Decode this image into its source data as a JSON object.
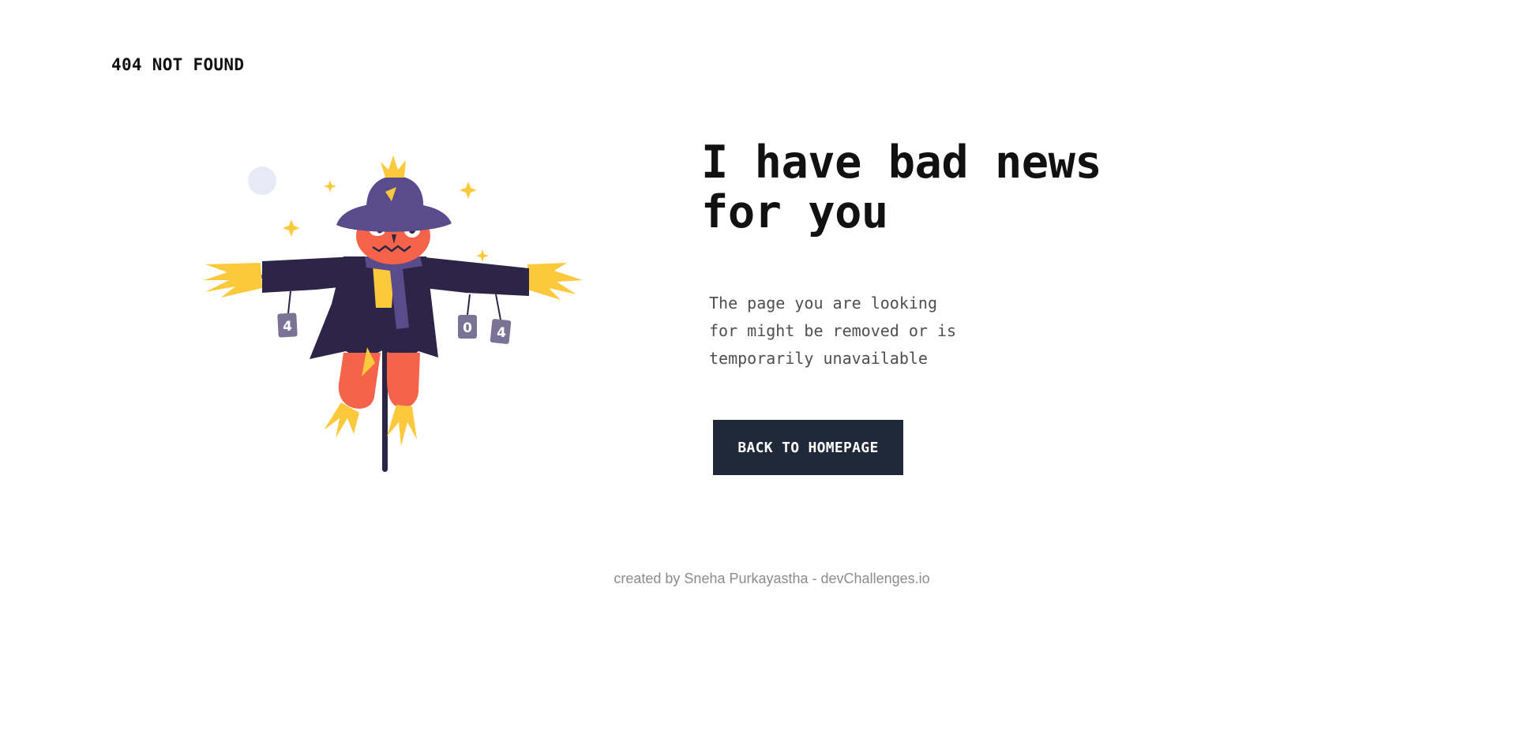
{
  "brand": {
    "label": "404 NOT FOUND"
  },
  "illustration": {
    "cans": [
      "4",
      "0",
      "4"
    ],
    "colors": {
      "hat": "#5a4c8c",
      "coat": "#2c2547",
      "face": "#f4634a",
      "straw": "#fcc93c",
      "scarf": "#5a4c8c",
      "moon": "#e7eaf4",
      "pole": "#2c2547"
    }
  },
  "main": {
    "headline": "I have bad news for you",
    "message": "The page you are looking for might be removed or is temporarily unavailable",
    "button_label": "BACK TO HOMEPAGE"
  },
  "footer": {
    "text": "created by Sneha Purkayastha - devChallenges.io"
  },
  "theme": {
    "button_bg": "#1f2937",
    "text_dark": "#111111",
    "text_muted": "#4f4f4f",
    "footer_text": "#8c8c8c"
  }
}
